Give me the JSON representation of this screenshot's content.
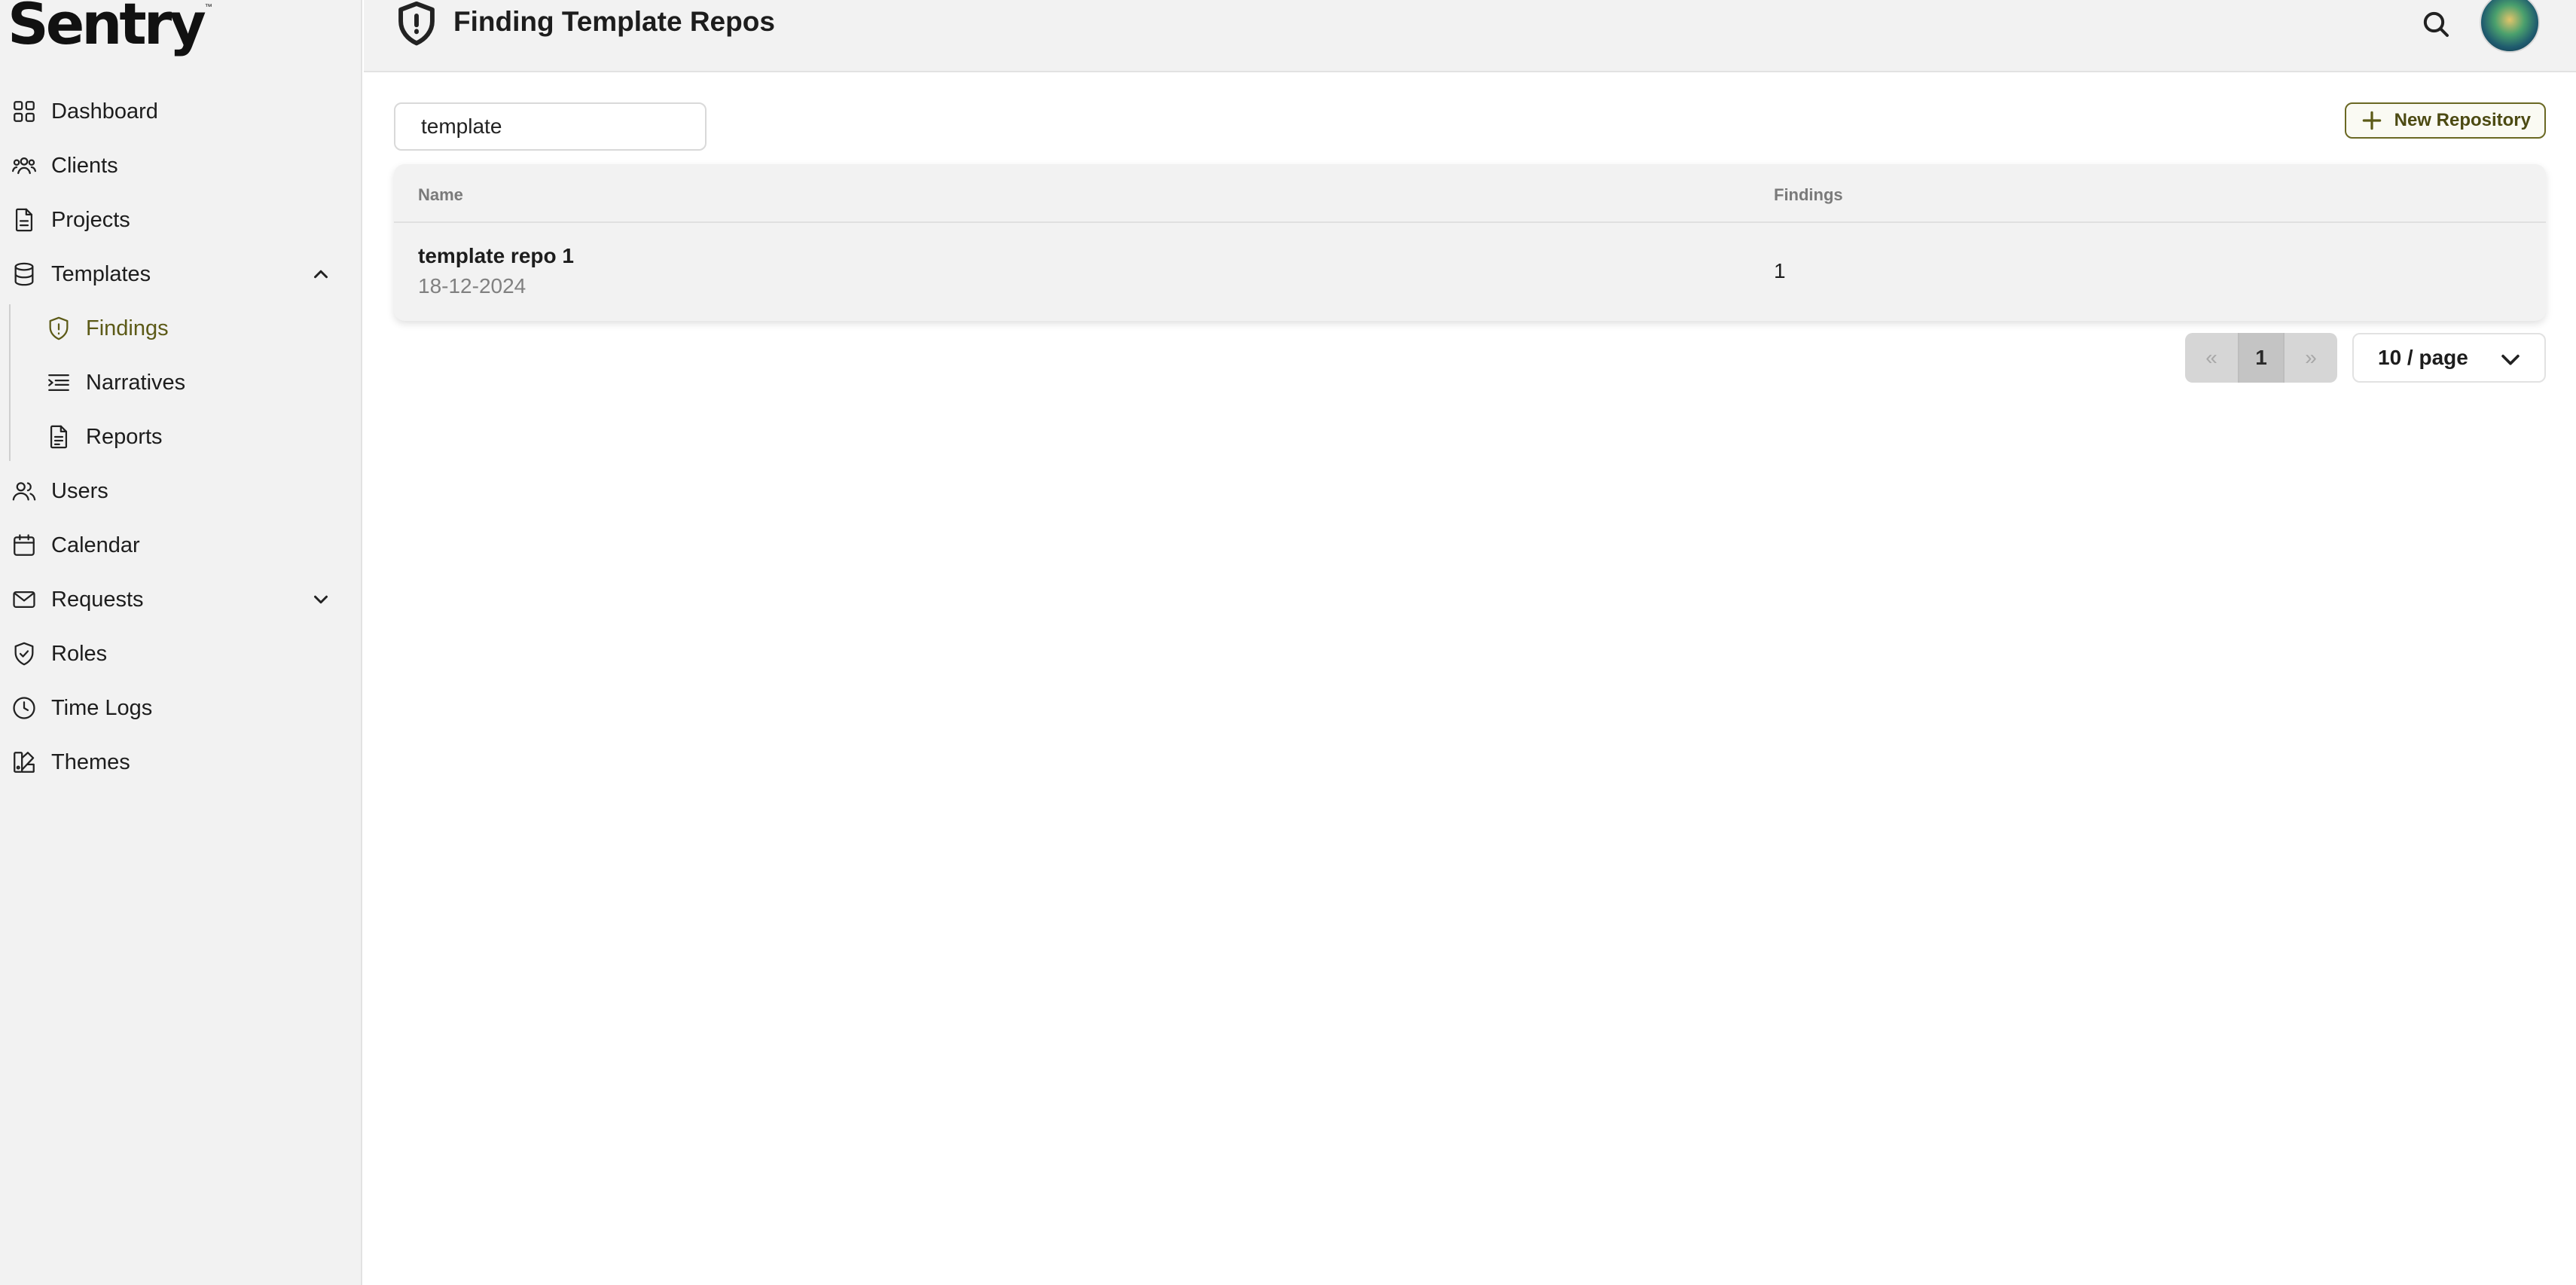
{
  "app": {
    "logo_text": "Sentry",
    "logo_tm": "™"
  },
  "sidebar": {
    "items": [
      {
        "label": "Dashboard",
        "icon": "dashboard-icon"
      },
      {
        "label": "Clients",
        "icon": "users-group-icon"
      },
      {
        "label": "Projects",
        "icon": "document-icon"
      },
      {
        "label": "Templates",
        "icon": "database-icon",
        "expanded": true,
        "children": [
          {
            "label": "Findings",
            "icon": "shield-alert-icon",
            "active": true
          },
          {
            "label": "Narratives",
            "icon": "list-indent-icon"
          },
          {
            "label": "Reports",
            "icon": "document-text-icon"
          }
        ]
      },
      {
        "label": "Users",
        "icon": "users-icon"
      },
      {
        "label": "Calendar",
        "icon": "calendar-icon"
      },
      {
        "label": "Requests",
        "icon": "mail-icon",
        "expanded": false
      },
      {
        "label": "Roles",
        "icon": "shield-check-icon"
      },
      {
        "label": "Time Logs",
        "icon": "clock-icon"
      },
      {
        "label": "Themes",
        "icon": "palette-icon"
      }
    ]
  },
  "header": {
    "title": "Finding Template Repos",
    "title_icon": "shield-alert-icon"
  },
  "search": {
    "value": "template"
  },
  "toolbar": {
    "new_repo_label": "New Repository"
  },
  "table": {
    "columns": [
      "Name",
      "Findings"
    ],
    "rows": [
      {
        "name": "template repo 1",
        "date": "18-12-2024",
        "findings": "1"
      }
    ]
  },
  "pagination": {
    "prev": "«",
    "current_page": "1",
    "next": "»",
    "page_size": "10 / page"
  },
  "colors": {
    "accent": "#5c5a17",
    "sidebar_bg": "#f2f2f2"
  }
}
